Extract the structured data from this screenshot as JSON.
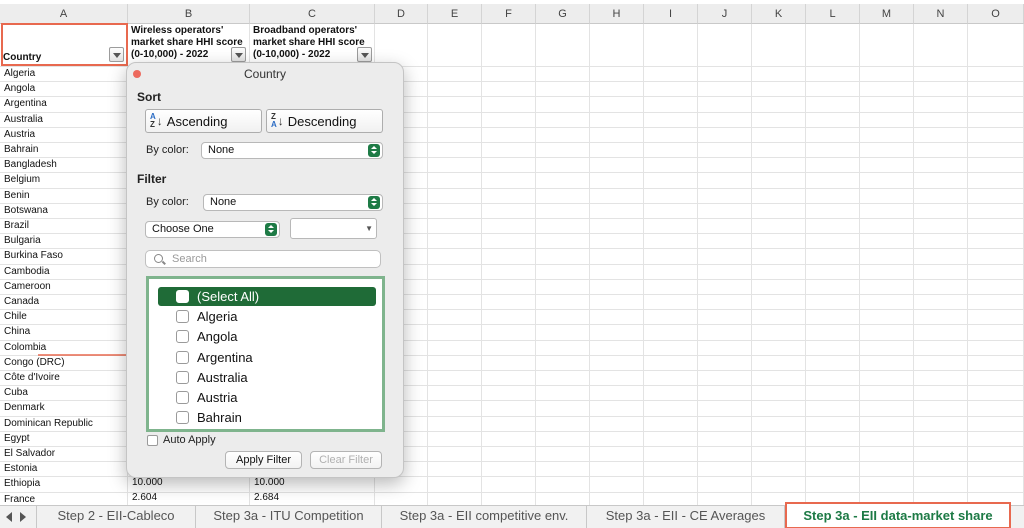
{
  "sheet": {
    "columns": [
      "A",
      "B",
      "C",
      "D",
      "E",
      "F",
      "G",
      "H",
      "I",
      "J",
      "K",
      "L",
      "M",
      "N",
      "O"
    ],
    "headers": {
      "country": "Country",
      "wireless": "Wireless operators' market share HHI score (0-10,000) - 2022",
      "broadband": "Broadband operators' market share HHI score (0-10,000) - 2022"
    },
    "countries": [
      "Algeria",
      "Angola",
      "Argentina",
      "Australia",
      "Austria",
      "Bahrain",
      "Bangladesh",
      "Belgium",
      "Benin",
      "Botswana",
      "Brazil",
      "Bulgaria",
      "Burkina Faso",
      "Cambodia",
      "Cameroon",
      "Canada",
      "Chile",
      "China",
      "Colombia",
      "Congo (DRC)",
      "Côte d'Ivoire",
      "Cuba",
      "Denmark",
      "Dominican Republic",
      "Egypt",
      "El Salvador",
      "Estonia",
      "Ethiopia",
      "France"
    ],
    "visible_values": {
      "ethiopia_b": "10.000",
      "ethiopia_c": "10.000",
      "france_b": "2.604",
      "france_c": "2.684"
    }
  },
  "popup": {
    "title": "Country",
    "sort_label": "Sort",
    "ascending": "Ascending",
    "descending": "Descending",
    "by_color": "By color:",
    "sort_color_value": "None",
    "filter_label": "Filter",
    "filter_color_value": "None",
    "choose_one": "Choose One",
    "criteria_value": "",
    "search_placeholder": "Search",
    "items": [
      "(Select All)",
      "Algeria",
      "Angola",
      "Argentina",
      "Australia",
      "Austria",
      "Bahrain"
    ],
    "auto_apply": "Auto Apply",
    "apply_filter": "Apply Filter",
    "clear_filter": "Clear Filter"
  },
  "tabs": [
    {
      "label": "Step 2 - EII-Cableco"
    },
    {
      "label": "Step 3a - ITU Competition"
    },
    {
      "label": "Step 3a - EII competitive env."
    },
    {
      "label": "Step 3a - EII - CE Averages"
    },
    {
      "label": "Step 3a - EII data-market share"
    }
  ],
  "colors": {
    "accent_green": "#1f6b37",
    "highlight_orange": "#e8694f",
    "list_border_green": "#7fb48d"
  }
}
